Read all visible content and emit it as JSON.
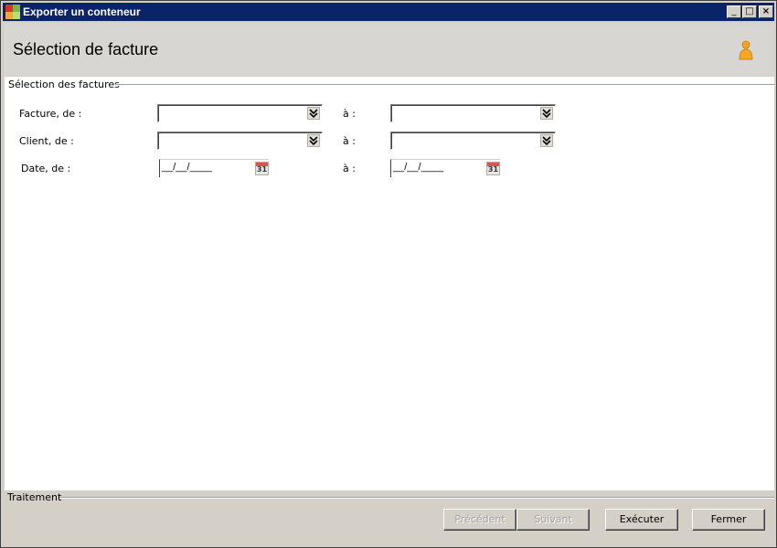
{
  "window": {
    "title": "Exporter un conteneur",
    "minimize_glyph": "_",
    "maximize_glyph": "□",
    "close_glyph": "×"
  },
  "header": {
    "title": "Sélection de facture",
    "user_icon": "user-icon"
  },
  "selection_group": {
    "legend": "Sélection des factures",
    "rows": [
      {
        "label": "Facture, de :",
        "to_label": "à :",
        "type": "combo",
        "from_value": "",
        "to_value": ""
      },
      {
        "label": "Client, de  :",
        "to_label": "à :",
        "type": "combo",
        "from_value": "",
        "to_value": ""
      },
      {
        "label": "Date, de  :",
        "to_label": "à :",
        "type": "date",
        "from_value": "__/__/____",
        "to_value": "__/__/____"
      }
    ],
    "dropdown_icon": "double-chevron-down-icon",
    "calendar_icon_text": "31"
  },
  "footer": {
    "legend": "Traitement",
    "buttons": {
      "previous": {
        "label": "Précédent",
        "enabled": false
      },
      "next": {
        "label": "Suivant",
        "enabled": false
      },
      "execute": {
        "label": "Exécuter",
        "enabled": true
      },
      "close": {
        "label": "Fermer",
        "enabled": true
      }
    }
  },
  "colors": {
    "titlebar": "#0a246a",
    "window_bg": "#d4d0c8",
    "header_bg": "#d8d6d2",
    "content_bg": "#ffffff",
    "user_icon": "#f5a623"
  }
}
